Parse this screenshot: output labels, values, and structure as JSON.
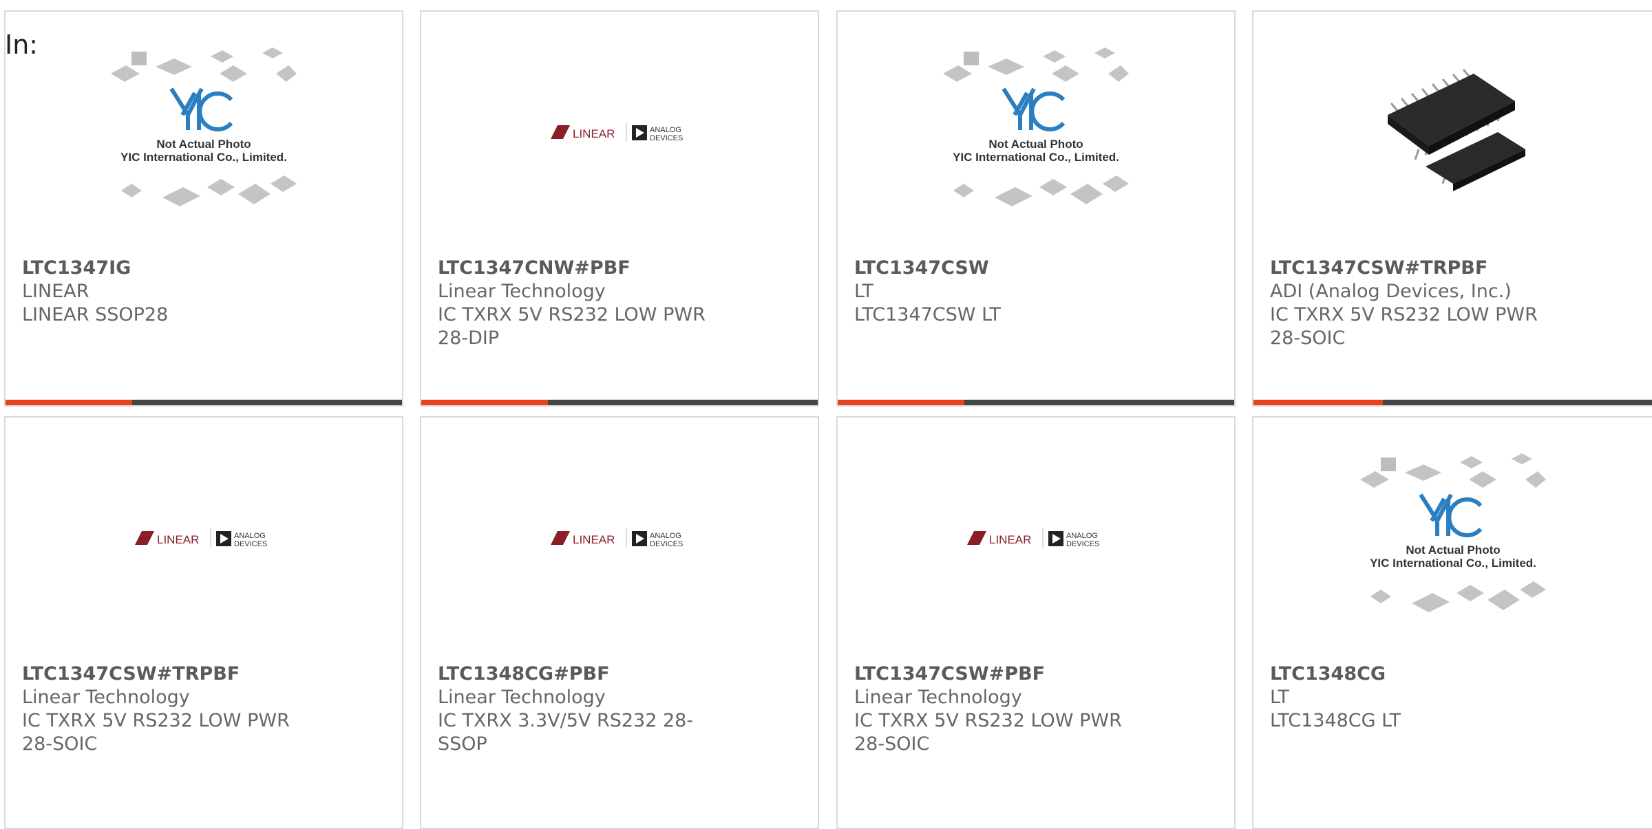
{
  "page": {
    "filter_label": "In:"
  },
  "colors": {
    "accent_bar": "#e8431d",
    "bar": "#444444",
    "border": "#dadada",
    "text": "#666666"
  },
  "products": [
    {
      "part": "LTC1347IG",
      "manufacturer": "LINEAR",
      "description": "LINEAR SSOP28",
      "image": "yic-placeholder",
      "progress": 0.32,
      "placeholder_text": [
        "Not Actual Photo",
        "YIC International Co., Limited."
      ]
    },
    {
      "part": "LTC1347CNW#PBF",
      "manufacturer": "Linear Technology",
      "description": "IC TXRX 5V RS232 LOW PWR 28-DIP",
      "image": "linear-adi-logo",
      "progress": 0.32,
      "logo_text": [
        "LINEAR",
        "ANALOG",
        "DEVICES"
      ]
    },
    {
      "part": "LTC1347CSW",
      "manufacturer": "LT",
      "description": "LTC1347CSW LT",
      "image": "yic-placeholder",
      "progress": 0.32,
      "placeholder_text": [
        "Not Actual Photo",
        "YIC International Co., Limited."
      ]
    },
    {
      "part": "LTC1347CSW#TRPBF",
      "manufacturer": "ADI (Analog Devices, Inc.)",
      "description": "IC TXRX 5V RS232 LOW PWR 28-SOIC",
      "image": "soic-chip-photo",
      "progress": 0.32
    },
    {
      "part": "LTC1347CSW#TRPBF",
      "manufacturer": "Linear Technology",
      "description": "IC TXRX 5V RS232 LOW PWR 28-SOIC",
      "image": "linear-adi-logo",
      "logo_text": [
        "LINEAR",
        "ANALOG",
        "DEVICES"
      ]
    },
    {
      "part": "LTC1348CG#PBF",
      "manufacturer": "Linear Technology",
      "description": "IC TXRX 3.3V/5V RS232 28-SSOP",
      "image": "linear-adi-logo",
      "logo_text": [
        "LINEAR",
        "ANALOG",
        "DEVICES"
      ]
    },
    {
      "part": "LTC1347CSW#PBF",
      "manufacturer": "Linear Technology",
      "description": "IC TXRX 5V RS232 LOW PWR 28-SOIC",
      "image": "linear-adi-logo",
      "logo_text": [
        "LINEAR",
        "ANALOG",
        "DEVICES"
      ]
    },
    {
      "part": "LTC1348CG",
      "manufacturer": "LT",
      "description": "LTC1348CG LT",
      "image": "yic-placeholder",
      "placeholder_text": [
        "Not Actual Photo",
        "YIC International Co., Limited."
      ]
    }
  ]
}
